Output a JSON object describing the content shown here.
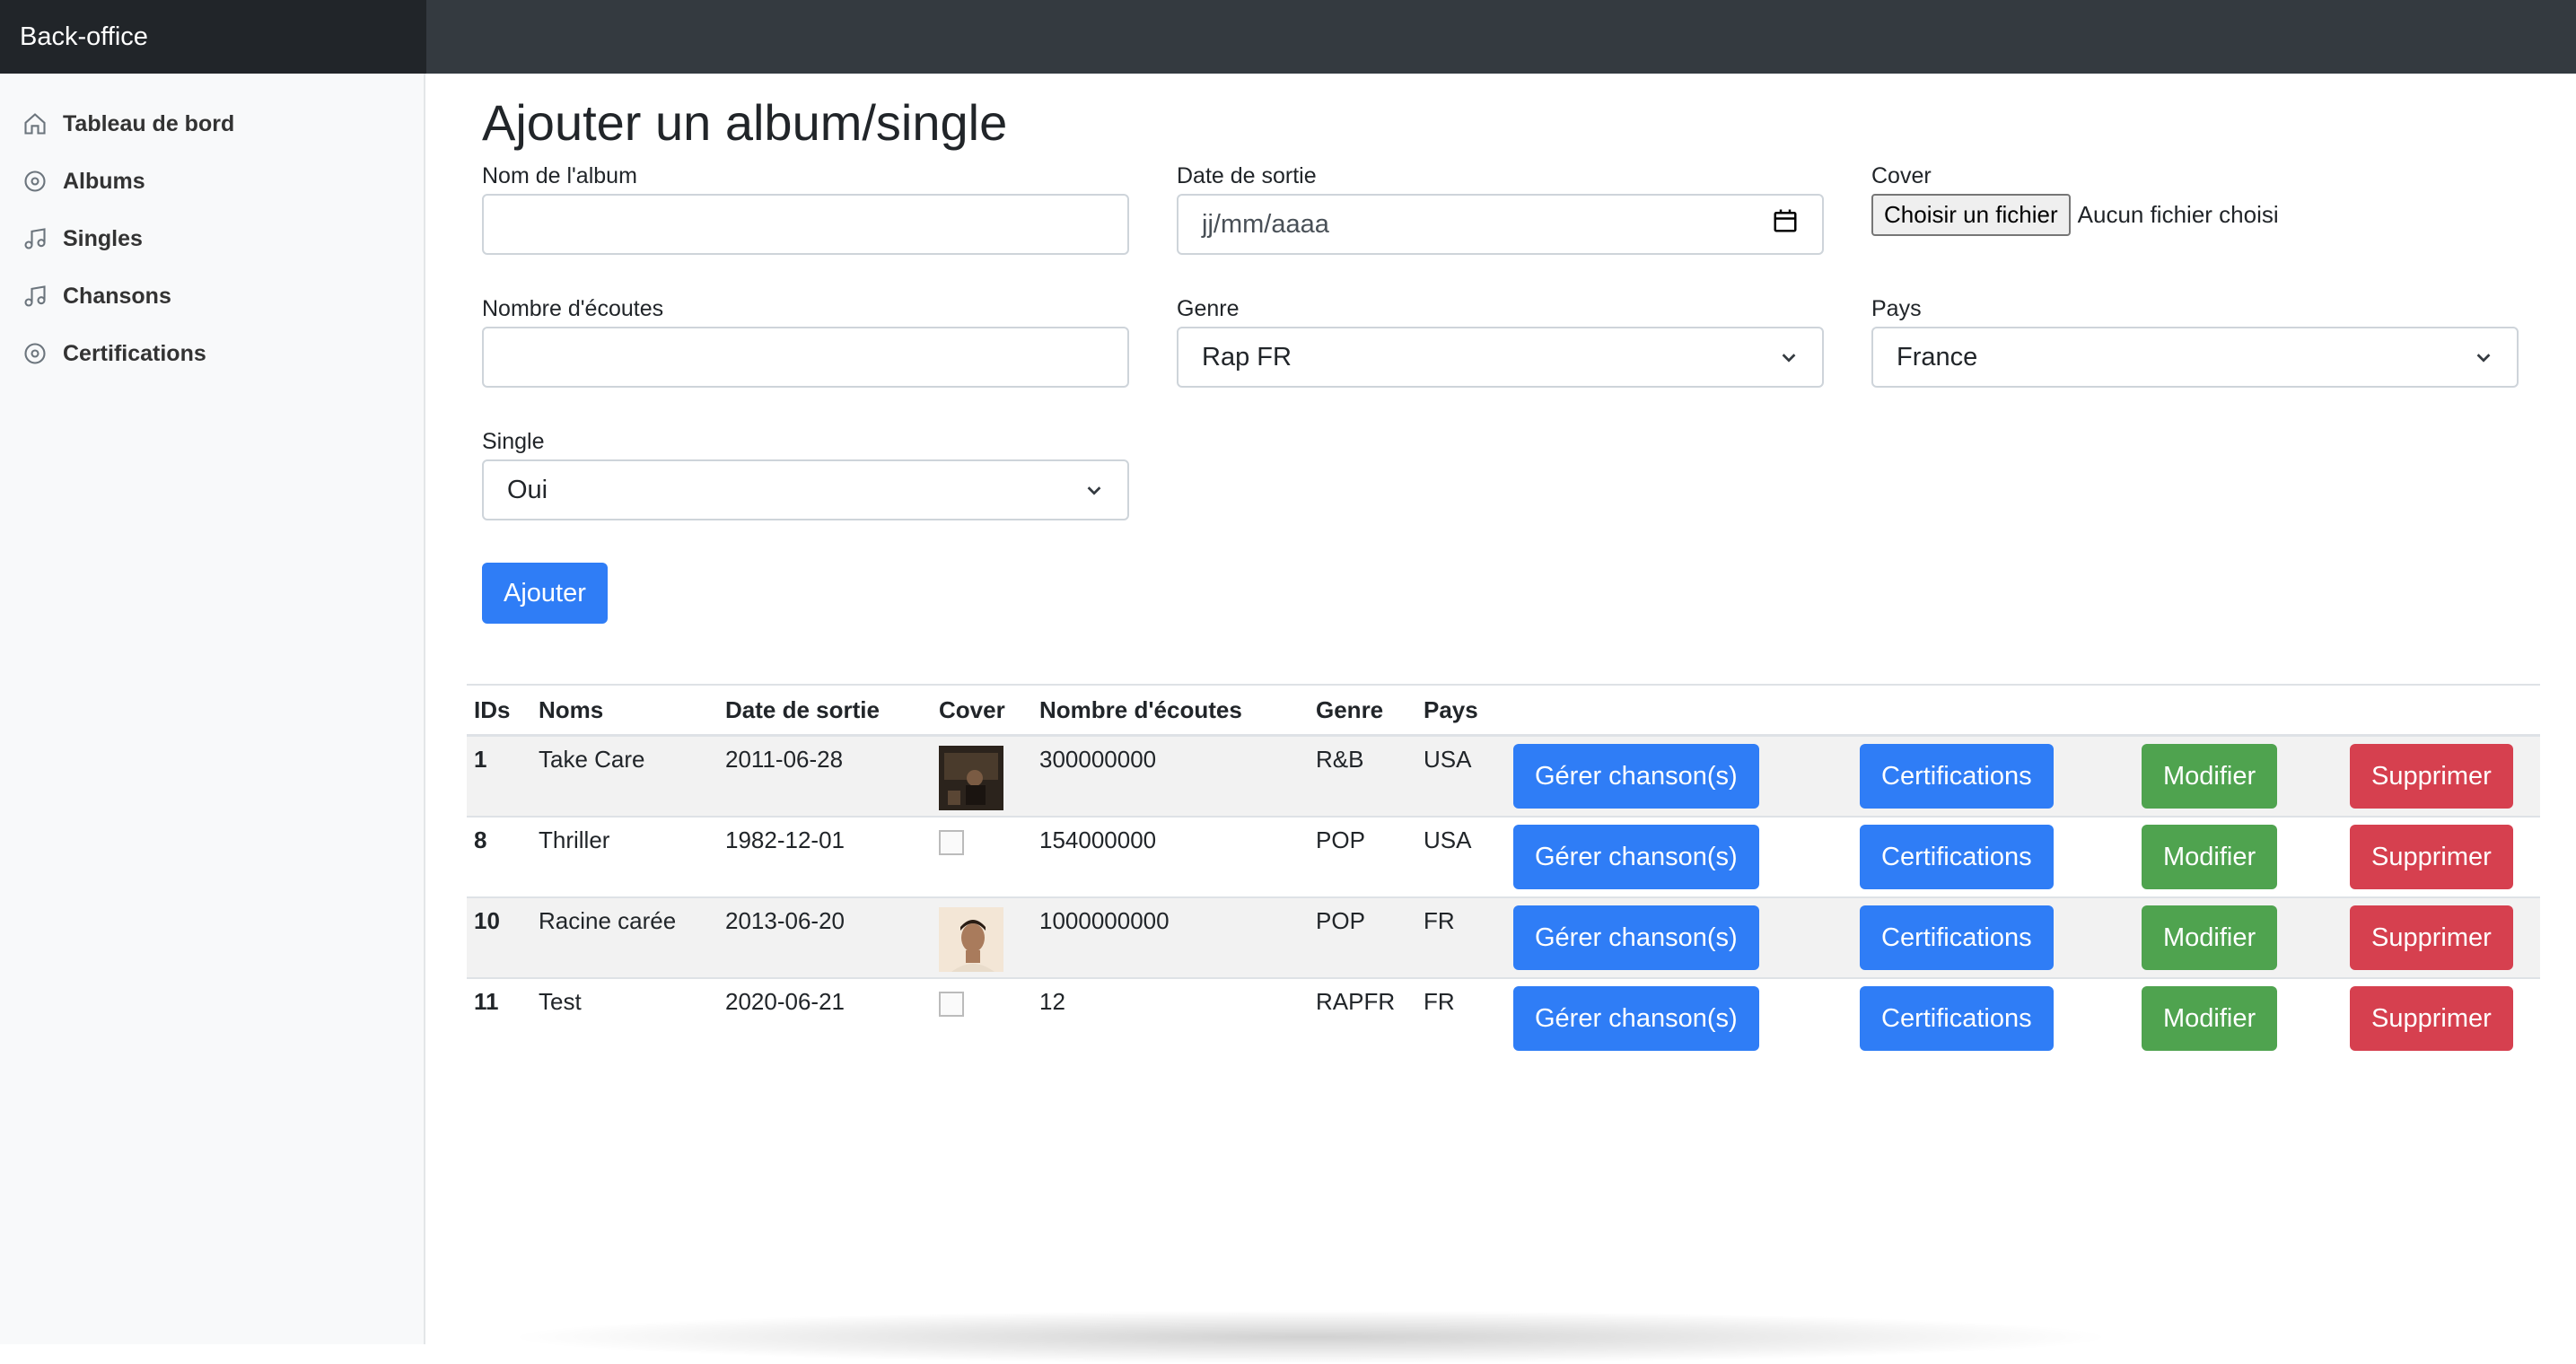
{
  "navbar": {
    "brand": "Back-office"
  },
  "sidebar": {
    "items": [
      {
        "label": "Tableau de bord",
        "icon": "home-icon"
      },
      {
        "label": "Albums",
        "icon": "disc-icon"
      },
      {
        "label": "Singles",
        "icon": "music-note-icon"
      },
      {
        "label": "Chansons",
        "icon": "music-note-icon"
      },
      {
        "label": "Certifications",
        "icon": "disc-icon"
      }
    ]
  },
  "form": {
    "title": "Ajouter un album/single",
    "album_name_label": "Nom de l'album",
    "album_name_value": "",
    "release_date_label": "Date de sortie",
    "release_date_placeholder": "jj/mm/aaaa",
    "cover_label": "Cover",
    "file_button": "Choisir un fichier",
    "file_status": "Aucun fichier choisi",
    "streams_label": "Nombre d'écoutes",
    "streams_value": "",
    "genre_label": "Genre",
    "genre_selected": "Rap FR",
    "country_label": "Pays",
    "country_selected": "France",
    "single_label": "Single",
    "single_selected": "Oui",
    "submit": "Ajouter"
  },
  "table": {
    "headers": [
      "IDs",
      "Noms",
      "Date de sortie",
      "Cover",
      "Nombre d'écoutes",
      "Genre",
      "Pays"
    ],
    "rows": [
      {
        "id": "1",
        "name": "Take Care",
        "date": "2011-06-28",
        "cover": "image",
        "streams": "300000000",
        "genre": "R&B",
        "country": "USA"
      },
      {
        "id": "8",
        "name": "Thriller",
        "date": "1982-12-01",
        "cover": "broken",
        "streams": "154000000",
        "genre": "POP",
        "country": "USA"
      },
      {
        "id": "10",
        "name": "Racine carée",
        "date": "2013-06-20",
        "cover": "image",
        "streams": "1000000000",
        "genre": "POP",
        "country": "FR"
      },
      {
        "id": "11",
        "name": "Test",
        "date": "2020-06-21",
        "cover": "broken",
        "streams": "12",
        "genre": "RAPFR",
        "country": "FR"
      }
    ],
    "actions": {
      "manage": "Gérer chanson(s)",
      "certifications": "Certifications",
      "edit": "Modifier",
      "delete": "Supprimer"
    }
  },
  "colors": {
    "primary": "#2f7df6",
    "success": "#4fa34f",
    "danger": "#d6404f",
    "navbar": "#343a40",
    "brand_bg": "#212529"
  }
}
